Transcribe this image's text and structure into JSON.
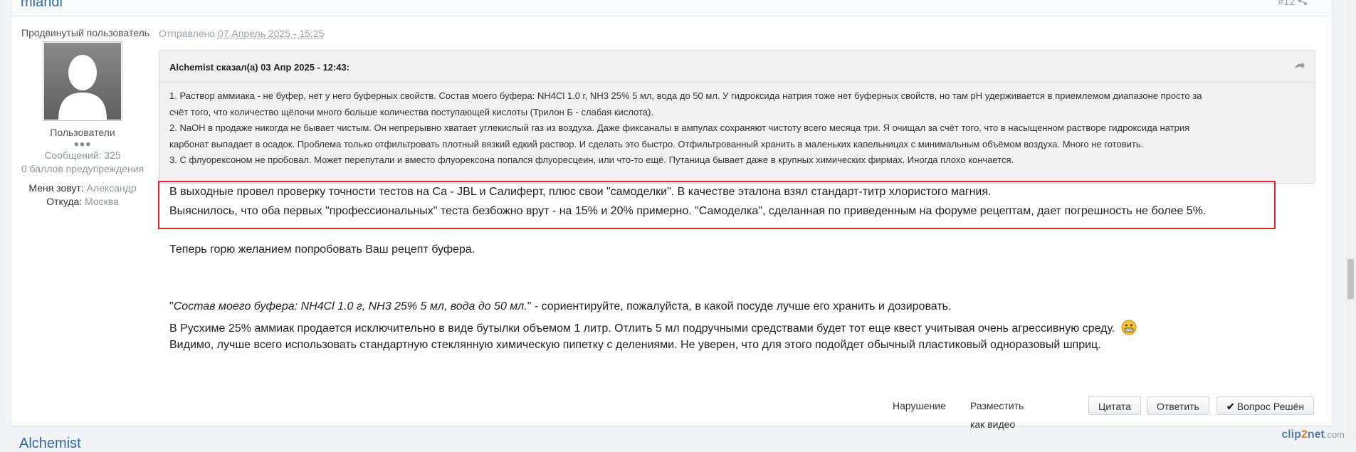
{
  "post": {
    "author_name": "mlandl",
    "post_number": "#12",
    "posted_prefix": "Отправлено",
    "posted_date": "07 Апрель 2025 - 15:25"
  },
  "author": {
    "title": "Продвинутый пользователь",
    "group": "Пользователи",
    "pips": "●●●",
    "posts_label": "Сообщений: 325",
    "warnings": "0 баллов предупреждения",
    "name_label": "Меня зовут:",
    "name_value": "Александр",
    "location_label": "Откуда:",
    "location_value": "Москва"
  },
  "quote": {
    "header": "Alchemist сказал(а) 03 Апр 2025 - 12:43:",
    "lines": [
      "1. Раствор аммиака - не буфер, нет у него буферных свойств. Состав моего буфера: NH4Cl 1.0 г, NH3 25% 5 мл, вода до 50 мл. У гидроксида натрия тоже нет буферных свойств, но там pH удерживается в приемлемом диапазоне просто за",
      "счёт того, что количество щёлочи много больше количества поступающей кислоты (Трилон Б - слабая кислота).",
      "2. NaOH в продаже никогда не бывает чистым. Он непрерывно хватает углекислый газ из воздуха. Даже фиксаналы в ампулах сохраняют чистоту всего месяца три. Я очищал за счёт того, что в насыщенном растворе гидроксида натрия",
      "карбонат выпадает в осадок. Проблема только отфильтровать плотный вязкий едкий раствор. И сделать это быстро. Отфильтрованный хранить в маленьких капельницах с минимальным объёмом воздуха. Много не готовить.",
      "3. С флуорексоном не пробовал. Может перепутали и вместо флуорексона попался флуоресцеин, или что-то ещё. Путаница бывает даже в крупных химических фирмах. Иногда плохо кончается."
    ]
  },
  "body": {
    "p1": "В выходные провел проверку точности тестов на Са - JBL и Салиферт, плюс свои  \"самоделки\". В качестве эталона взял стандарт-титр хлористого магния.",
    "p2": "Выяснилось, что оба первых \"профессиональных\" теста безбожно врут - на 15% и 20% примерно. \"Самоделка\", сделанная по приведенным на форуме рецептам, дает погрешность не более 5%.",
    "p3": "Теперь горю желанием попробовать Ваш рецепт буфера.",
    "p4_open": "\"",
    "p4_italic": "Состав моего буфера: NH4Cl 1.0 г, NH3 25% 5 мл, вода до 50 мл.",
    "p4_rest": "\" - сориентируйте, пожалуйста, в какой посуде лучше его хранить и дозировать.",
    "p5": "В Русхиме 25% аммиак продается исключительно в виде бутылки объемом 1 литр. Отлить 5 мл подручными средствами будет тот еще квест учитывая очень агрессивную среду.",
    "p6": "Видимо, лучше всего использовать стандартную стеклянную химическую пипетку с делениями. Не уверен, что для этого подойдет обычный пластиковый одноразовый шприц."
  },
  "actions": {
    "report": "Нарушение",
    "video": "Разместить как видео",
    "quote": "Цитата",
    "reply": "Ответить",
    "solved": "Вопрос Решён"
  },
  "next_post": {
    "author_name": "Alchemist"
  },
  "watermark": {
    "part1": "clip",
    "part2": "2",
    "part3": "net",
    "part4": ".com"
  }
}
